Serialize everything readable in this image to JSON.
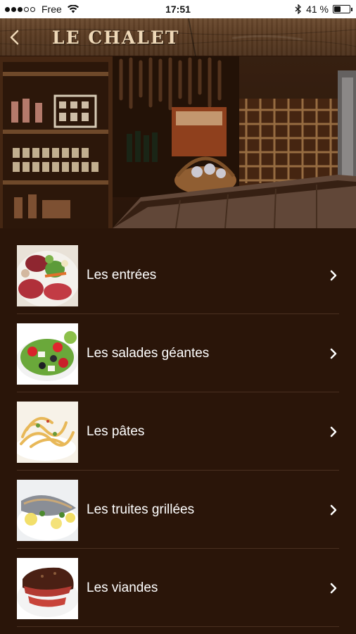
{
  "status_bar": {
    "carrier": "Free",
    "time": "17:51",
    "battery_percent": "41 %",
    "battery_level": 0.41,
    "signal_bars_filled": 3,
    "signal_bars_total": 5
  },
  "header": {
    "title": "LE CHALET",
    "back_icon": "chevron-left-icon"
  },
  "menu": {
    "items": [
      {
        "label": "Les entrées",
        "icon": "chevron-right-icon"
      },
      {
        "label": "Les salades géantes",
        "icon": "chevron-right-icon"
      },
      {
        "label": "Les pâtes",
        "icon": "chevron-right-icon"
      },
      {
        "label": "Les truites grillées",
        "icon": "chevron-right-icon"
      },
      {
        "label": "Les viandes",
        "icon": "chevron-right-icon"
      }
    ]
  },
  "colors": {
    "background": "#2a1509",
    "header_wood": "#5a3b22",
    "title": "#efd9b8",
    "divider": "#4a3020"
  }
}
